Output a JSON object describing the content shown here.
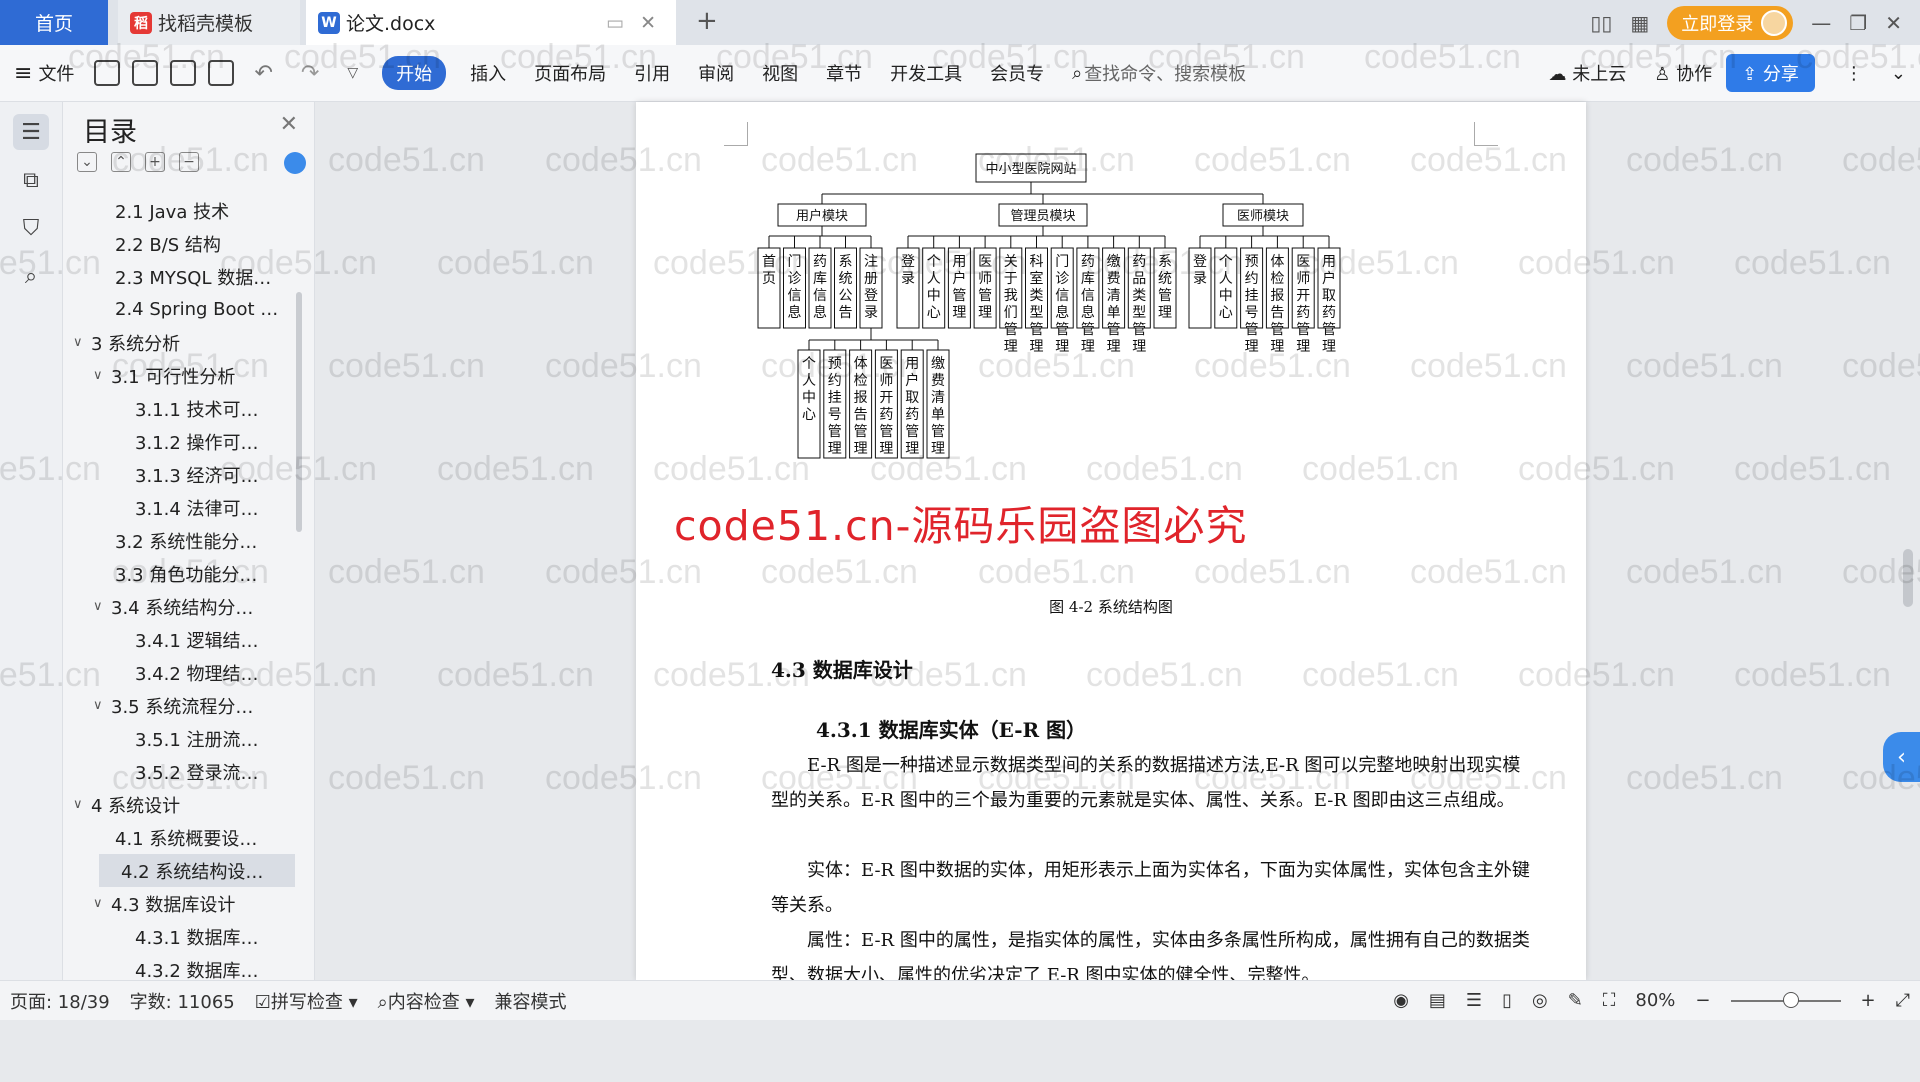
{
  "tabs": {
    "home": "首页",
    "templates": "找稻壳模板",
    "doc": "论文.docx"
  },
  "titlebar": {
    "login": "立即登录"
  },
  "ribbon": {
    "file": "文件",
    "items": [
      "开始",
      "插入",
      "页面布局",
      "引用",
      "审阅",
      "视图",
      "章节",
      "开发工具",
      "会员专"
    ],
    "search_placeholder": "查找命令、搜索模板",
    "cloud": "未上云",
    "collab": "协作",
    "share": "分享"
  },
  "toc": {
    "title": "目录",
    "items": [
      {
        "label": "2.1 Java 技术",
        "level": 2,
        "exp": ""
      },
      {
        "label": "2.2 B/S 结构",
        "level": 2,
        "exp": ""
      },
      {
        "label": "2.3 MYSQL 数据…",
        "level": 2,
        "exp": ""
      },
      {
        "label": "2.4 Spring Boot …",
        "level": 2,
        "exp": ""
      },
      {
        "label": "3  系统分析",
        "level": 1,
        "exp": "v"
      },
      {
        "label": "3.1  可行性分析",
        "level": 2,
        "exp": "v"
      },
      {
        "label": "3.1.1  技术可…",
        "level": 3,
        "exp": ""
      },
      {
        "label": "3.1.2  操作可…",
        "level": 3,
        "exp": ""
      },
      {
        "label": "3.1.3  经济可…",
        "level": 3,
        "exp": ""
      },
      {
        "label": "3.1.4  法律可…",
        "level": 3,
        "exp": ""
      },
      {
        "label": "3.2  系统性能分…",
        "level": 2,
        "exp": ""
      },
      {
        "label": "3.3  角色功能分…",
        "level": 2,
        "exp": ""
      },
      {
        "label": "3.4  系统结构分…",
        "level": 2,
        "exp": "v"
      },
      {
        "label": "3.4.1 逻辑结…",
        "level": 3,
        "exp": ""
      },
      {
        "label": "3.4.2 物理结…",
        "level": 3,
        "exp": ""
      },
      {
        "label": "3.5  系统流程分…",
        "level": 2,
        "exp": "v"
      },
      {
        "label": "3.5.1 注册流…",
        "level": 3,
        "exp": ""
      },
      {
        "label": "3.5.2 登录流…",
        "level": 3,
        "exp": ""
      },
      {
        "label": "4  系统设计",
        "level": 1,
        "exp": "v"
      },
      {
        "label": "4.1  系统概要设…",
        "level": 2,
        "exp": ""
      },
      {
        "label": "4.2  系统结构设…",
        "level": 2,
        "exp": "",
        "selected": true
      },
      {
        "label": "4.3  数据库设计",
        "level": 2,
        "exp": "v"
      },
      {
        "label": "4.3.1 数据库…",
        "level": 3,
        "exp": ""
      },
      {
        "label": "4.3.2 数据库…",
        "level": 3,
        "exp": ""
      }
    ]
  },
  "doc": {
    "diagram": {
      "root": "中小型医院网站",
      "groups": [
        {
          "name": "用户模块",
          "children": [
            "首页",
            "门诊信息",
            "药库信息",
            "系统公告",
            "注册登录"
          ]
        },
        {
          "name": "管理员模块",
          "children": [
            "登录",
            "个人中心",
            "用户管理",
            "医师管理",
            "关于我们管理",
            "科室类型管理",
            "门诊信息管理",
            "药库信息管理",
            "缴费清单管理",
            "药品类型管理",
            "系统管理"
          ]
        },
        {
          "name": "医师模块",
          "children": [
            "登录",
            "个人中心",
            "预约挂号管理",
            "体检报告管理",
            "医师开药管理",
            "用户取药管理"
          ]
        }
      ],
      "sub_children": [
        "个人中心",
        "预约挂号管理",
        "体检报告管理",
        "医师开药管理",
        "用户取药管理",
        "缴费清单管理"
      ]
    },
    "caption": "图 4-2 系统结构图",
    "notice": "code51.cn-源码乐园盗图必究",
    "h1": "4.3  数据库设计",
    "h2": "4.3.1 数据库实体（E-R 图）",
    "paragraphs": [
      "E-R 图是一种描述显示数据类型间的关系的数据描述方法,E-R 图可以完整地映射出现实模型的关系。E-R 图中的三个最为重要的元素就是实体、属性、关系。E-R 图即由这三点组成。",
      "实体：E-R 图中数据的实体，用矩形表示上面为实体名，下面为实体属性，实体包含主外键等关系。",
      "属性：E-R 图中的属性，是指实体的属性，实体由多条属性所构成，属性拥有自己的数据类型、数据大小、属性的优劣决定了 E-R 图中实体的健全性、完整性。"
    ]
  },
  "watermark": "code51.cn",
  "status": {
    "page": "页面: 18/39",
    "words": "字数: 11065",
    "spell": "拼写检查",
    "content": "内容检查",
    "compat": "兼容模式",
    "zoom": "80%",
    "zoom_level": 0.55
  }
}
